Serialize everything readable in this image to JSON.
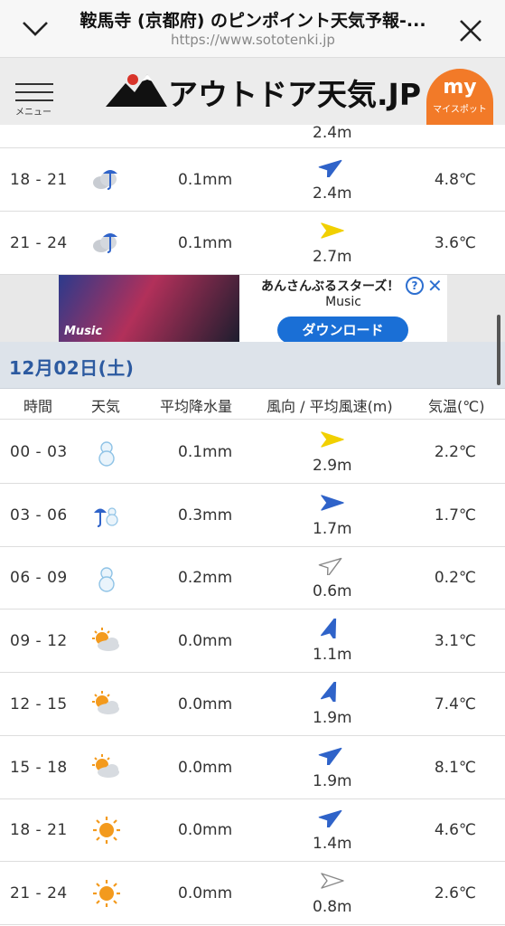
{
  "browser": {
    "title": "鞍馬寺 (京都府) のピンポイント天気予報-...",
    "url": "https://www.sototenki.jp"
  },
  "site": {
    "menu_label": "メニュー",
    "logo_text": "アウトドア天気.JP",
    "myspot_icon": "my",
    "myspot_label": "マイスポット"
  },
  "top_partial": {
    "speed": "2.4m"
  },
  "day1_rows": [
    {
      "time": "18 - 21",
      "weather": "cloud-rain",
      "precip": "0.1mm",
      "wind_dir": "ne",
      "wind_color": "#2f63c9",
      "speed": "2.4m",
      "temp": "4.8℃"
    },
    {
      "time": "21 - 24",
      "weather": "cloud-rain",
      "precip": "0.1mm",
      "wind_dir": "e",
      "wind_color": "#f1d000",
      "speed": "2.7m",
      "temp": "3.6℃"
    }
  ],
  "ad": {
    "title": "あんさんぶるスターズ！",
    "subtitle": "Music",
    "button": "ダウンロード",
    "info": "?",
    "close": "✕",
    "banner_text": "Music"
  },
  "date_label": "12月02日(土)",
  "headers": {
    "time": "時間",
    "weather": "天気",
    "precip": "平均降水量",
    "wind": "風向 / 平均風速(m)",
    "temp": "気温(℃)"
  },
  "day2_rows": [
    {
      "time": "00 - 03",
      "weather": "snow",
      "precip": "0.1mm",
      "wind_dir": "e",
      "wind_color": "#f1d000",
      "speed": "2.9m",
      "temp": "2.2℃"
    },
    {
      "time": "03 - 06",
      "weather": "rain-snow",
      "precip": "0.3mm",
      "wind_dir": "e",
      "wind_color": "#2f63c9",
      "speed": "1.7m",
      "temp": "1.7℃"
    },
    {
      "time": "06 - 09",
      "weather": "snow",
      "precip": "0.2mm",
      "wind_dir": "ne",
      "wind_color": "#999999",
      "speed": "0.6m",
      "temp": "0.2℃"
    },
    {
      "time": "09 - 12",
      "weather": "sun-cloud",
      "precip": "0.0mm",
      "wind_dir": "n",
      "wind_color": "#2f63c9",
      "speed": "1.1m",
      "temp": "3.1℃"
    },
    {
      "time": "12 - 15",
      "weather": "sun-cloud",
      "precip": "0.0mm",
      "wind_dir": "n",
      "wind_color": "#2f63c9",
      "speed": "1.9m",
      "temp": "7.4℃"
    },
    {
      "time": "15 - 18",
      "weather": "sun-cloud",
      "precip": "0.0mm",
      "wind_dir": "ne",
      "wind_color": "#2f63c9",
      "speed": "1.9m",
      "temp": "8.1℃"
    },
    {
      "time": "18 - 21",
      "weather": "sun",
      "precip": "0.0mm",
      "wind_dir": "ne",
      "wind_color": "#2f63c9",
      "speed": "1.4m",
      "temp": "4.6℃"
    },
    {
      "time": "21 - 24",
      "weather": "sun",
      "precip": "0.0mm",
      "wind_dir": "e",
      "wind_color": "#999999",
      "speed": "0.8m",
      "temp": "2.6℃"
    }
  ]
}
